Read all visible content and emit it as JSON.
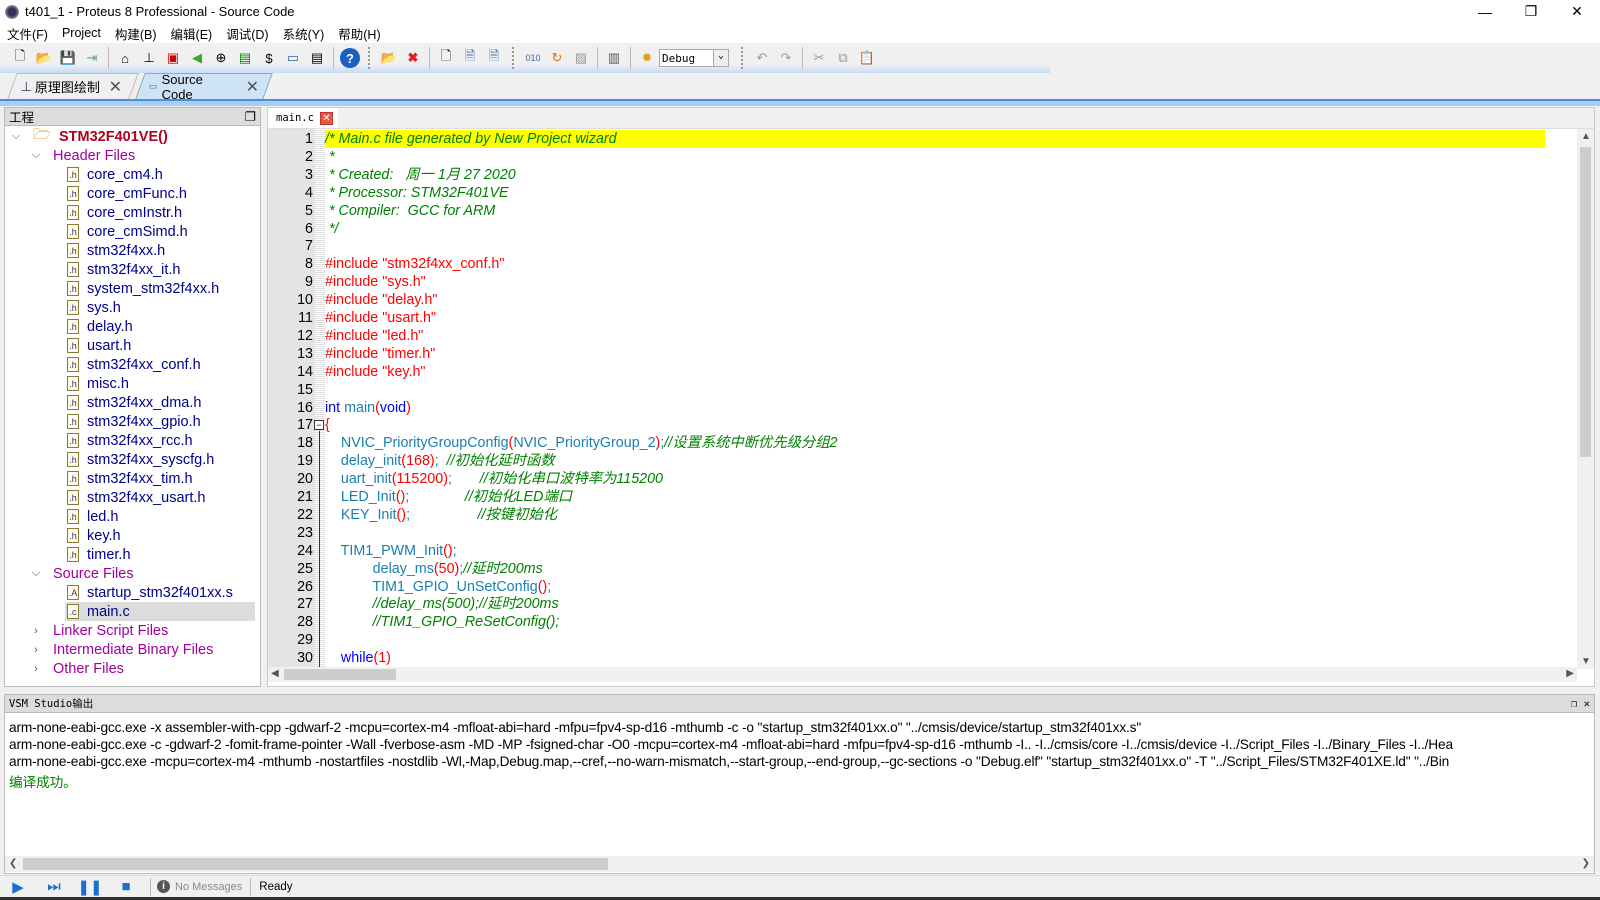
{
  "window": {
    "title": "t401_1 - Proteus 8 Professional - Source Code"
  },
  "menu": [
    "文件(F)",
    "Project",
    "构建(B)",
    "编辑(E)",
    "调试(D)",
    "系统(Y)",
    "帮助(H)"
  ],
  "toolbar": {
    "config_select": "Debug"
  },
  "doc_tabs": [
    {
      "label": "原理图绘制",
      "active": false
    },
    {
      "label": "Source Code",
      "active": true
    }
  ],
  "project_panel": {
    "title": "工程",
    "root": "STM32F401VE()",
    "folders": [
      {
        "label": "Header Files",
        "expanded": true,
        "files": [
          "core_cm4.h",
          "core_cmFunc.h",
          "core_cmInstr.h",
          "core_cmSimd.h",
          "stm32f4xx.h",
          "stm32f4xx_it.h",
          "system_stm32f4xx.h",
          "sys.h",
          "delay.h",
          "usart.h",
          "stm32f4xx_conf.h",
          "misc.h",
          "stm32f4xx_dma.h",
          "stm32f4xx_gpio.h",
          "stm32f4xx_rcc.h",
          "stm32f4xx_syscfg.h",
          "stm32f4xx_tim.h",
          "stm32f4xx_usart.h",
          "led.h",
          "key.h",
          "timer.h"
        ]
      },
      {
        "label": "Source Files",
        "expanded": true,
        "files": [
          "startup_stm32f401xx.s",
          "main.c"
        ]
      },
      {
        "label": "Linker Script Files",
        "expanded": false,
        "files": []
      },
      {
        "label": "Intermediate Binary Files",
        "expanded": false,
        "files": []
      },
      {
        "label": "Other Files",
        "expanded": false,
        "files": []
      }
    ],
    "selected_file": "main.c"
  },
  "editor": {
    "tab": "main.c",
    "highlight_color": "#ffff00",
    "lines": [
      [
        [
          "cm",
          "/* Main.c file generated by New Project wizard"
        ]
      ],
      [
        [
          "cm",
          " *"
        ]
      ],
      [
        [
          "cm",
          " * Created:   周一 1月 27 2020"
        ]
      ],
      [
        [
          "cm",
          " * Processor: STM32F401VE"
        ]
      ],
      [
        [
          "cm",
          " * Compiler:  GCC for ARM"
        ]
      ],
      [
        [
          "cm",
          " */"
        ]
      ],
      [],
      [
        [
          "pp",
          "#include \"stm32f4xx_conf.h\""
        ]
      ],
      [
        [
          "pp",
          "#include \"sys.h\""
        ]
      ],
      [
        [
          "pp",
          "#include \"delay.h\""
        ]
      ],
      [
        [
          "pp",
          "#include \"usart.h\""
        ]
      ],
      [
        [
          "pp",
          "#include \"led.h\""
        ]
      ],
      [
        [
          "pp",
          "#include \"timer.h\""
        ]
      ],
      [
        [
          "pp",
          "#include \"key.h\""
        ]
      ],
      [],
      [
        [
          "kw",
          "int"
        ],
        [
          "fn",
          " main"
        ],
        [
          "pa",
          "("
        ],
        [
          "kw",
          "void"
        ],
        [
          "pa",
          ")"
        ]
      ],
      [
        [
          "pa",
          "{"
        ]
      ],
      [
        [
          "fn",
          "    NVIC_PriorityGroupConfig"
        ],
        [
          "pa",
          "("
        ],
        [
          "fn",
          "NVIC_PriorityGroup_2"
        ],
        [
          "pa",
          ")"
        ],
        [
          "fn",
          ";"
        ],
        [
          "cm",
          "//设置系统中断优先级分组2"
        ]
      ],
      [
        [
          "fn",
          "    delay_init"
        ],
        [
          "pa",
          "("
        ],
        [
          "nm",
          "168"
        ],
        [
          "pa",
          ")"
        ],
        [
          "fn",
          ";  "
        ],
        [
          "cm",
          "//初始化延时函数"
        ]
      ],
      [
        [
          "fn",
          "    uart_init"
        ],
        [
          "pa",
          "("
        ],
        [
          "nm",
          "115200"
        ],
        [
          "pa",
          ")"
        ],
        [
          "fn",
          ";       "
        ],
        [
          "cm",
          "//初始化串口波特率为115200"
        ]
      ],
      [
        [
          "fn",
          "    LED_Init"
        ],
        [
          "pa",
          "()"
        ],
        [
          "fn",
          ";              "
        ],
        [
          "cm",
          "//初始化LED端口"
        ]
      ],
      [
        [
          "fn",
          "    KEY_Init"
        ],
        [
          "pa",
          "()"
        ],
        [
          "fn",
          ";                 "
        ],
        [
          "cm",
          "//按键初始化"
        ]
      ],
      [],
      [
        [
          "fn",
          "    TIM1_PWM_Init"
        ],
        [
          "pa",
          "()"
        ],
        [
          "fn",
          ";"
        ]
      ],
      [
        [
          "fn",
          "            delay_ms"
        ],
        [
          "pa",
          "("
        ],
        [
          "nm",
          "50"
        ],
        [
          "pa",
          ")"
        ],
        [
          "fn",
          ";"
        ],
        [
          "cm",
          "//延时200ms"
        ]
      ],
      [
        [
          "fn",
          "            TIM1_GPIO_UnSetConfig"
        ],
        [
          "pa",
          "()"
        ],
        [
          "fn",
          ";"
        ]
      ],
      [
        [
          "cm",
          "            //delay_ms(500);//延时200ms"
        ]
      ],
      [
        [
          "cm",
          "            //TIM1_GPIO_ReSetConfig();"
        ]
      ],
      [],
      [
        [
          "kw",
          "    while"
        ],
        [
          "pa",
          "(1)"
        ]
      ]
    ]
  },
  "output_panel": {
    "title": "VSM Studio输出",
    "lines": [
      "arm-none-eabi-gcc.exe -x assembler-with-cpp -gdwarf-2 -mcpu=cortex-m4 -mfloat-abi=hard -mfpu=fpv4-sp-d16 -mthumb -c  -o \"startup_stm32f401xx.o\" \"../cmsis/device/startup_stm32f401xx.s\"",
      "arm-none-eabi-gcc.exe -c -gdwarf-2 -fomit-frame-pointer -Wall -fverbose-asm -MD -MP -fsigned-char -O0 -mcpu=cortex-m4 -mfloat-abi=hard -mfpu=fpv4-sp-d16 -mthumb -I.. -I../cmsis/core -I../cmsis/device -I../Script_Files -I../Binary_Files -I../Hea",
      "arm-none-eabi-gcc.exe -mcpu=cortex-m4 -mthumb -nostartfiles -nostdlib  -Wl,-Map,Debug.map,--cref,--no-warn-mismatch,--start-group,--end-group,--gc-sections -o \"Debug.elf\" \"startup_stm32f401xx.o\" -T \"../Script_Files/STM32F401XE.ld\" \"../Bin"
    ],
    "success": "编译成功。",
    "success_color": "#008000"
  },
  "status": {
    "messages": "No Messages",
    "state": "Ready"
  }
}
